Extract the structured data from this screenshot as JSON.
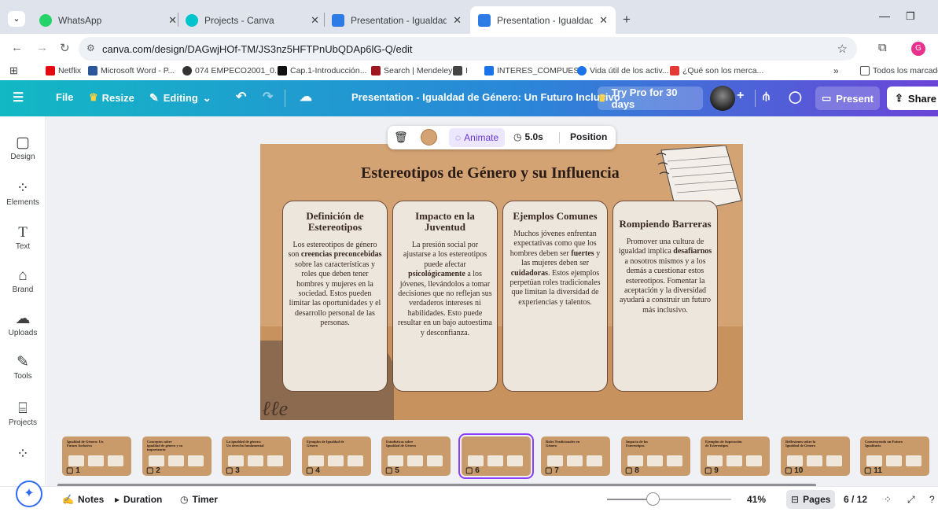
{
  "browser": {
    "tabs": [
      {
        "title": "WhatsApp",
        "active": false
      },
      {
        "title": "Projects - Canva",
        "active": false
      },
      {
        "title": "Presentation - Igualdad de Gén",
        "active": false
      },
      {
        "title": "Presentation - Igualdad de Gén",
        "active": true
      }
    ],
    "url": "canva.com/design/DAGwjHOf-TM/JS3nz5HFTPnUbQDAp6lG-Q/edit",
    "bookmarks": [
      "Netflix",
      "Microsoft Word - P...",
      "074 EMPECO2001_0...",
      "Cap.1-Introducción...",
      "Search | Mendeley",
      "I",
      "INTERES_COMPUES...",
      "Vida útil de los activ...",
      "¿Qué son los merca..."
    ],
    "bookmarks_overflow": "»",
    "all_bookmarks": "Todos los marcadores",
    "profile_initial": "G"
  },
  "header": {
    "file": "File",
    "resize": "Resize",
    "editing": "Editing",
    "title": "Presentation - Igualdad de Género: Un Futuro Inclusivo",
    "try_pro": "Try Pro for 30 days",
    "present": "Present",
    "share": "Share"
  },
  "rail": [
    "Design",
    "Elements",
    "Text",
    "Brand",
    "Uploads",
    "Tools",
    "Projects"
  ],
  "toolbar": {
    "animate": "Animate",
    "duration": "5.0s",
    "position": "Position"
  },
  "slide": {
    "title": "Estereotipos de Género y su Influencia",
    "cards": [
      {
        "heading": "Definición de Estereotipos",
        "pre": "Los estereotipos de género son ",
        "bold": "creencias preconcebidas",
        "post": " sobre las características y roles que deben tener hombres y mujeres en la sociedad. Estos pueden limitar las oportunidades y el desarrollo personal de las personas."
      },
      {
        "heading": "Impacto en la Juventud",
        "pre": "La presión social por ajustarse a los estereotipos puede afectar ",
        "bold": "psicológicamente",
        "post": " a los jóvenes, llevándolos a tomar decisiones que no reflejan sus verdaderos intereses ni habilidades. Esto puede resultar en un bajo autoestima y desconfianza."
      },
      {
        "heading": "Ejemplos Comunes",
        "pre": "Muchos jóvenes enfrentan expectativas como que los hombres deben ser ",
        "bold": "fuertes",
        "mid": " y las mujeres deben ser ",
        "bold2": "cuidadoras",
        "post": ". Estos ejemplos perpetúan roles tradicionales que limitan la diversidad de experiencias y talentos."
      },
      {
        "heading": "Rompiendo Barreras",
        "pre": "Promover una cultura de igualdad implica ",
        "bold": "desafiarnos",
        "post": " a nosotros mismos y a los demás a cuestionar estos estereotipos. Fomentar la aceptación y la diversidad ayudará a construir un futuro más inclusivo."
      }
    ]
  },
  "thumbnails": [
    {
      "num": "1",
      "title": "Igualdad de Género: Un Futuro Inclusivo"
    },
    {
      "num": "2",
      "title": "Conceptos sobre igualdad de género y su importancia"
    },
    {
      "num": "3",
      "title": "La igualdad de género: Un derecho fundamental"
    },
    {
      "num": "4",
      "title": "Ejemplos de Igualdad de Género"
    },
    {
      "num": "5",
      "title": "Estadísticas sobre Igualdad de Género"
    },
    {
      "num": "6",
      "title": ""
    },
    {
      "num": "7",
      "title": "Roles Tradicionales en Género"
    },
    {
      "num": "8",
      "title": "Impacto de los Estereotipos"
    },
    {
      "num": "9",
      "title": "Ejemplos de Superación de Estereotipos"
    },
    {
      "num": "10",
      "title": "Reflexiones sobre la Igualdad de Género"
    },
    {
      "num": "11",
      "title": "Construyendo un Futuro Igualitario"
    }
  ],
  "bottom": {
    "notes": "Notes",
    "duration": "Duration",
    "timer": "Timer",
    "zoom": "41%",
    "pages": "Pages",
    "page_count": "6 / 12",
    "zoom_level": 0.41
  }
}
